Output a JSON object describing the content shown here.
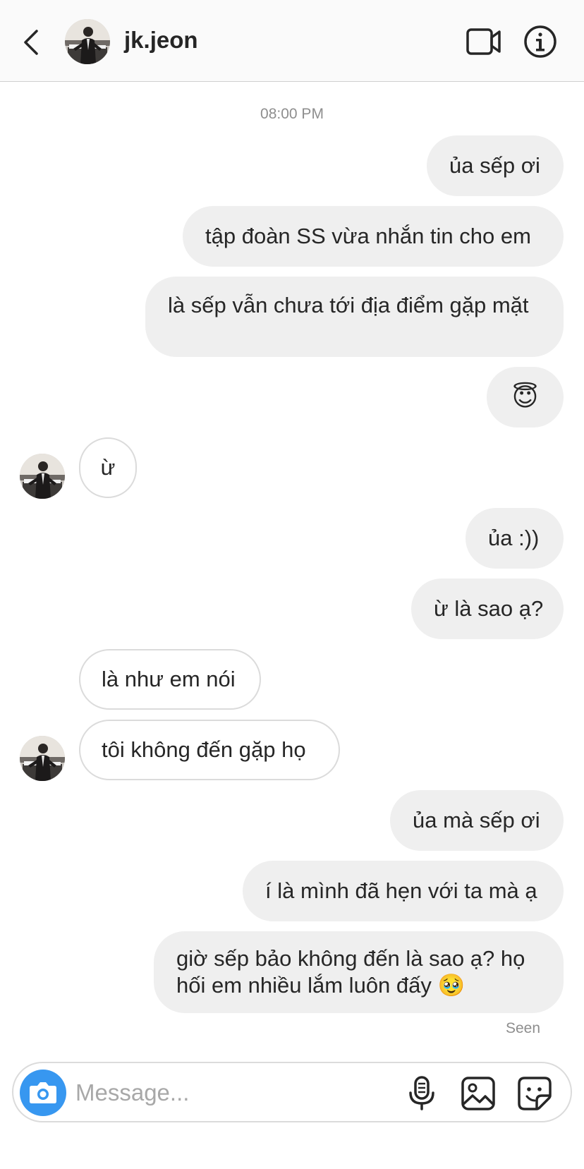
{
  "header": {
    "username": "jk.jeon",
    "back_icon": "chevron-left-icon",
    "video_icon": "video-camera-icon",
    "info_icon": "info-icon"
  },
  "thread": {
    "timestamp": "08:00 PM",
    "messages": [
      {
        "from": "me",
        "text": "ủa sếp ơi"
      },
      {
        "from": "me",
        "text": "tập đoàn SS vừa nhắn tin cho em"
      },
      {
        "from": "me",
        "text": "là sếp vẫn chưa tới địa điểm gặp mặt"
      },
      {
        "from": "me",
        "text": "😇"
      },
      {
        "from": "them",
        "text": "ừ"
      },
      {
        "from": "me",
        "text": "ủa :))"
      },
      {
        "from": "me",
        "text": "ừ là sao ạ?"
      },
      {
        "from": "them",
        "text": "là như em nói"
      },
      {
        "from": "them",
        "text": "tôi không đến gặp họ"
      },
      {
        "from": "me",
        "text": "ủa mà sếp ơi"
      },
      {
        "from": "me",
        "text": "í là mình đã hẹn với ta mà ạ"
      },
      {
        "from": "me",
        "text": "giờ sếp bảo không đến là sao ạ? họ hối em nhiều lắm luôn đấy 🥹"
      }
    ],
    "seen_label": "Seen"
  },
  "composer": {
    "placeholder": "Message...",
    "camera_icon": "camera-icon",
    "mic_icon": "microphone-icon",
    "gallery_icon": "image-icon",
    "sticker_icon": "sticker-icon"
  },
  "colors": {
    "accent": "#3797f0",
    "outgoing_bubble": "#efefef",
    "incoming_border": "#dbdbdb",
    "secondary_text": "#8e8e8e"
  }
}
